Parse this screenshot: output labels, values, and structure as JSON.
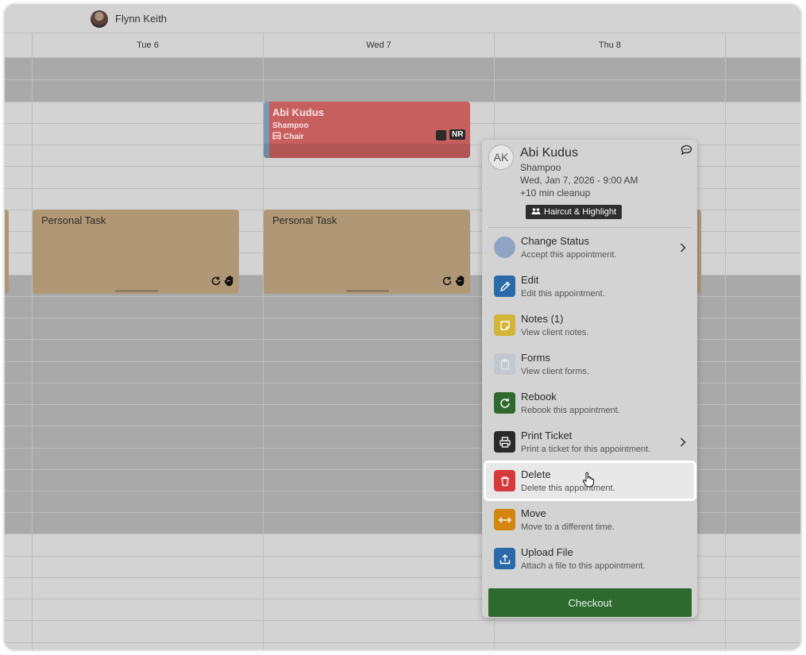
{
  "staff": {
    "name": "Flynn Keith"
  },
  "days": [
    {
      "label": ""
    },
    {
      "label": "Tue 6"
    },
    {
      "label": "Wed 7"
    },
    {
      "label": "Thu 8"
    },
    {
      "label": ""
    }
  ],
  "appointment": {
    "client": "Abi Kudus",
    "service": "Shampoo",
    "resource": "Chair",
    "badge": "NR",
    "color": "#c75f5f"
  },
  "tasks": [
    {
      "title": "Personal Task"
    },
    {
      "title": "Personal Task"
    }
  ],
  "popover": {
    "initials": "AK",
    "client": "Abi Kudus",
    "service": "Shampoo",
    "datetime": "Wed, Jan 7, 2026 - 9:00 AM",
    "cleanup": "+10 min cleanup",
    "tag": "Haircut & Highlight",
    "menu": [
      {
        "title": "Change Status",
        "subtitle": "Accept this appointment.",
        "icon": "status-circle-icon",
        "color": "#8fa3c4"
      },
      {
        "title": "Edit",
        "subtitle": "Edit this appointment.",
        "icon": "pencil-icon",
        "color": "#2b6aa8"
      },
      {
        "title": "Notes (1)",
        "subtitle": "View client notes.",
        "icon": "note-icon",
        "color": "#d4b437"
      },
      {
        "title": "Forms",
        "subtitle": "View client forms.",
        "icon": "clipboard-icon",
        "color": "#c2c8ce"
      },
      {
        "title": "Rebook",
        "subtitle": "Rebook this appointment.",
        "icon": "rebook-icon",
        "color": "#2e6a2e"
      },
      {
        "title": "Print Ticket",
        "subtitle": "Print a ticket for this appointment.",
        "icon": "printer-icon",
        "color": "#2a2a2a"
      },
      {
        "title": "Delete",
        "subtitle": "Delete this appointment.",
        "icon": "trash-icon",
        "color": "#d6393a"
      },
      {
        "title": "Move",
        "subtitle": "Move to a different time.",
        "icon": "move-arrows-icon",
        "color": "#d4860f"
      },
      {
        "title": "Upload File",
        "subtitle": "Attach a file to this appointment.",
        "icon": "upload-icon",
        "color": "#2b6aa8"
      }
    ],
    "checkout_label": "Checkout"
  }
}
